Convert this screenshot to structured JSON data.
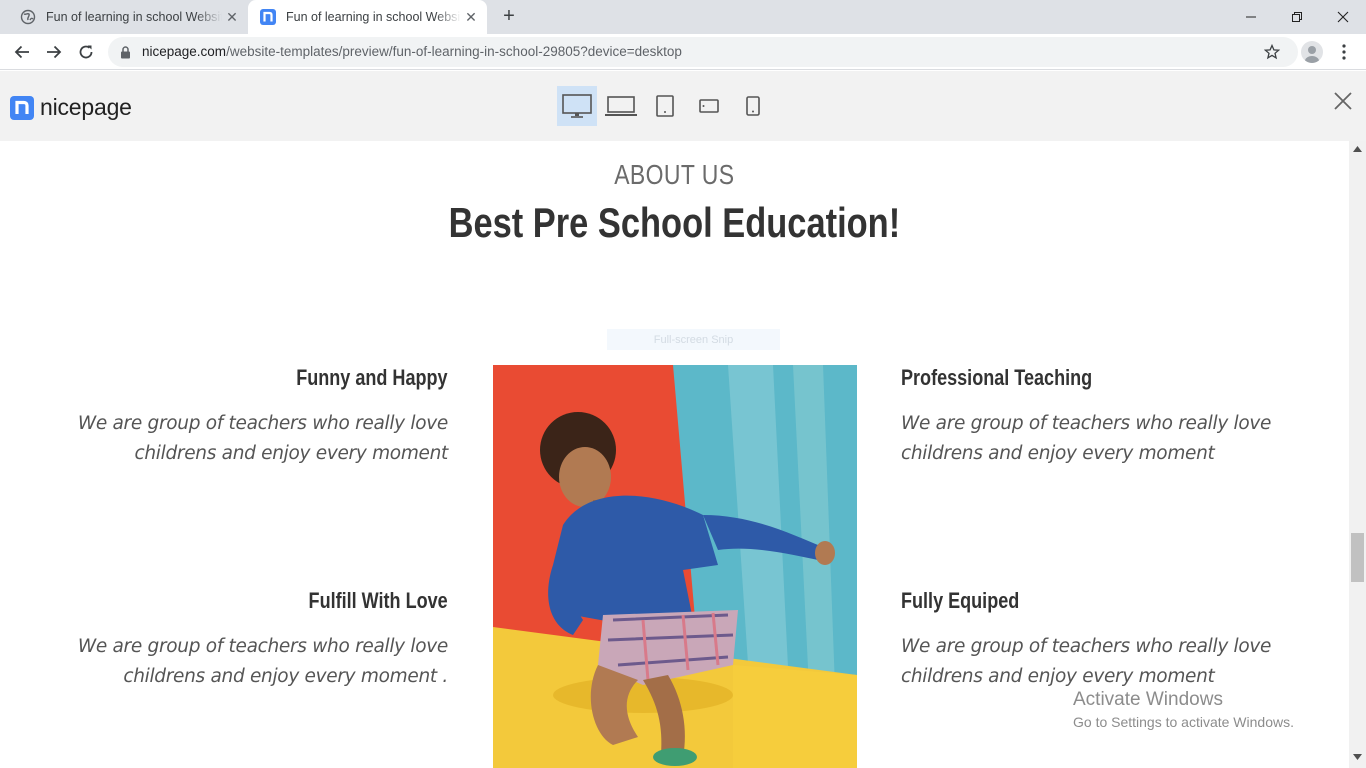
{
  "browser": {
    "tabs": [
      {
        "title": "Fun of learning in school Website",
        "active": false,
        "icon": "globe-icon"
      },
      {
        "title": "Fun of learning in school Website",
        "active": true,
        "icon": "nicepage-favicon"
      }
    ],
    "url_host": "nicepage.com",
    "url_path": "/website-templates/preview/fun-of-learning-in-school-29805?device=desktop"
  },
  "nicepage": {
    "logo_text": "nicepage",
    "devices": [
      "desktop",
      "laptop",
      "tablet",
      "tablet-landscape",
      "phone"
    ],
    "active_device": "desktop",
    "accent": "#4285f4"
  },
  "section": {
    "subtitle": "ABOUT US",
    "title": "Best Pre School Education!",
    "features": [
      {
        "title": "Funny and Happy",
        "desc1": "We are group of teachers who really love",
        "desc2": "childrens and enjoy every moment"
      },
      {
        "title": "Professional Teaching",
        "desc1": "We are group of teachers who really love",
        "desc2": "childrens and enjoy every moment"
      },
      {
        "title": "Fulfill With Love",
        "desc1": "We are group of teachers who really love",
        "desc2": "childrens and enjoy every moment ."
      },
      {
        "title": "Fully Equiped",
        "desc1": "We are group of teachers who really love",
        "desc2": "childrens and enjoy every moment"
      }
    ]
  },
  "overlay": {
    "snip_label": "Full-screen Snip"
  },
  "watermark": {
    "line1": "Activate Windows",
    "line2": "Go to Settings to activate Windows."
  }
}
